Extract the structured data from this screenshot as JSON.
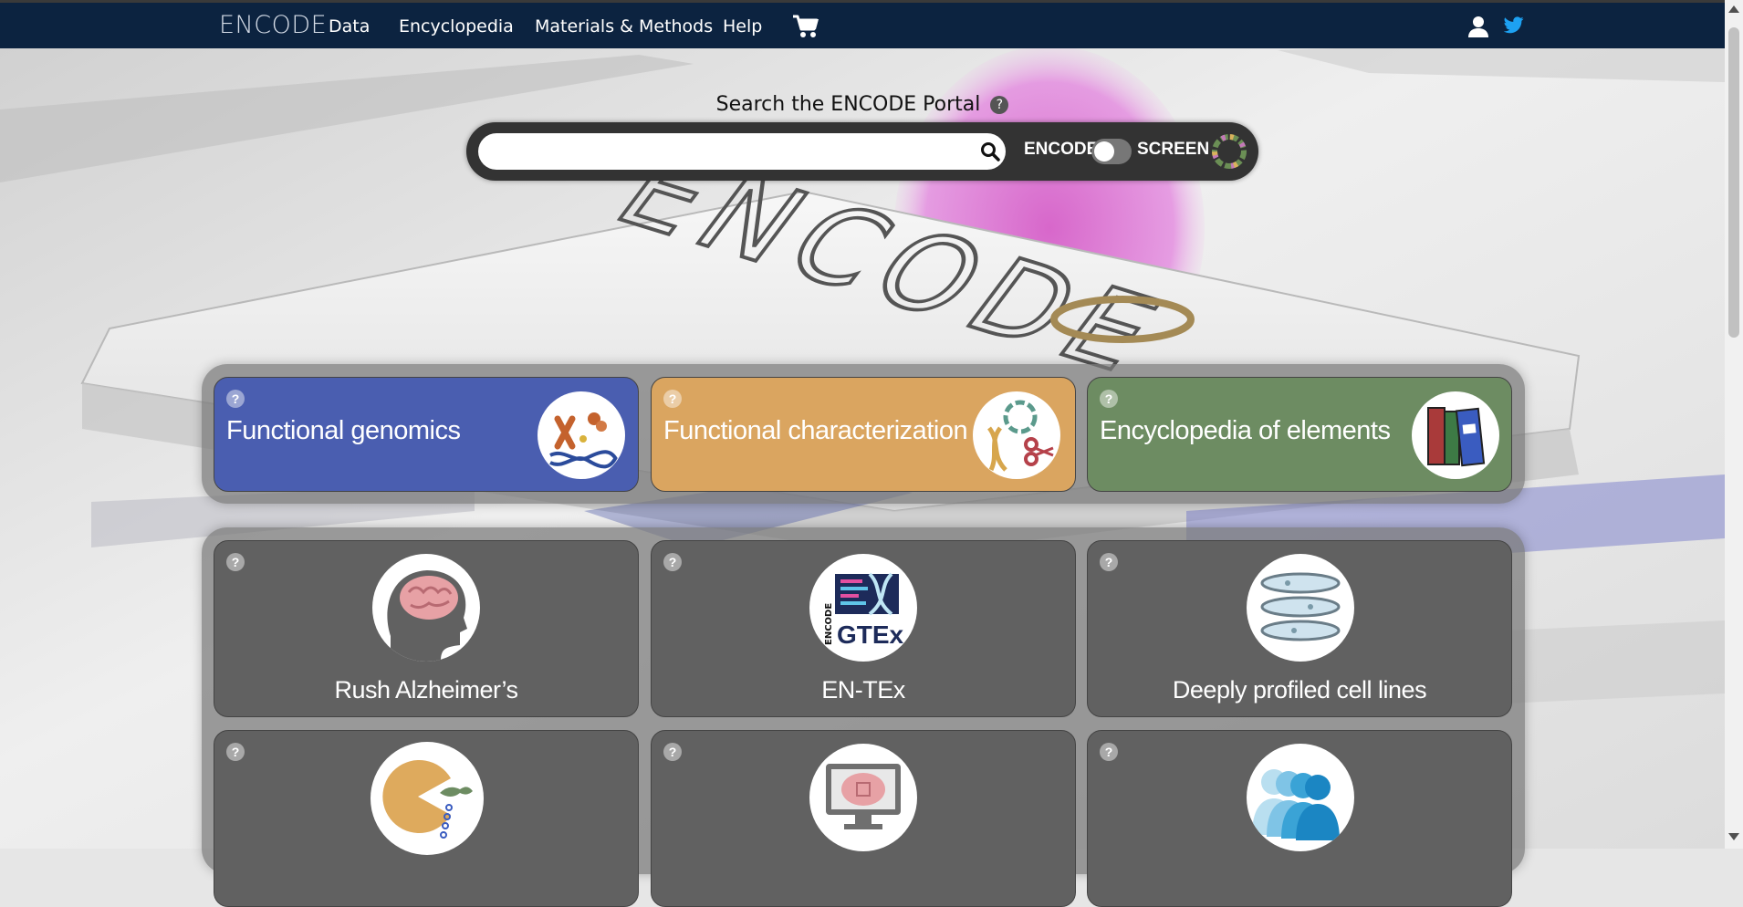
{
  "nav": {
    "brand": "ENCODE",
    "items": [
      "Data",
      "Encyclopedia",
      "Materials & Methods",
      "Help"
    ],
    "icons": [
      "cart-icon",
      "user-icon",
      "twitter-icon"
    ]
  },
  "search": {
    "title": "Search the ENCODE Portal",
    "help": "?",
    "value": "",
    "placeholder": "",
    "toggle_left": "ENCODE",
    "toggle_right": "SCREEN"
  },
  "colors": {
    "nav_bg": "#0c2340",
    "functional_genomics": "#4a5eb0",
    "functional_characterization": "#daa560",
    "encyclopedia": "#6d8c62",
    "dark_card": "#616161"
  },
  "top_cards": [
    {
      "label": "Functional genomics",
      "help": "?",
      "icon": "chromosome-dna-icon"
    },
    {
      "label": "Functional characterization",
      "help": "?",
      "icon": "dna-scissors-icon"
    },
    {
      "label": "Encyclopedia of elements",
      "help": "?",
      "icon": "books-icon"
    }
  ],
  "project_cards": [
    {
      "label": "Rush Alzheimer’s",
      "help": "?",
      "icon": "brain-head-icon"
    },
    {
      "label": "EN-TEx",
      "help": "?",
      "icon": "encode-gtex-icon"
    },
    {
      "label": "Deeply profiled cell lines",
      "help": "?",
      "icon": "petri-dish-stack-icon"
    },
    {
      "label": "",
      "help": "?",
      "icon": "pacman-dna-icon"
    },
    {
      "label": "",
      "help": "?",
      "icon": "brain-computer-icon"
    },
    {
      "label": "",
      "help": "?",
      "icon": "people-silhouettes-icon"
    }
  ],
  "logos": {
    "encode_gtex_vertical": "ENCODE",
    "encode_gtex_main": "GTEx"
  }
}
